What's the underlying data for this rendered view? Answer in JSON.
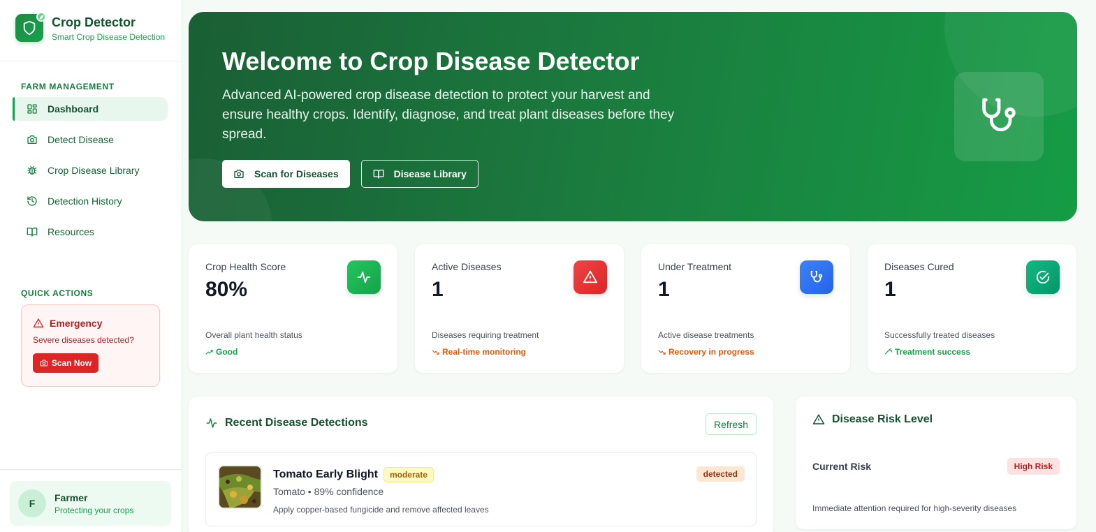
{
  "app": {
    "title": "Crop Detector",
    "subtitle": "Smart Crop Disease Detection"
  },
  "sidebar": {
    "section_label": "FARM MANAGEMENT",
    "items": [
      {
        "label": "Dashboard",
        "icon": "layout-grid-icon",
        "active": true
      },
      {
        "label": "Detect Disease",
        "icon": "camera-icon"
      },
      {
        "label": "Crop Disease Library",
        "icon": "bug-icon"
      },
      {
        "label": "Detection History",
        "icon": "history-icon"
      },
      {
        "label": "Resources",
        "icon": "book-open-icon"
      }
    ],
    "quick_actions_label": "QUICK ACTIONS",
    "emergency": {
      "title": "Emergency",
      "text": "Severe diseases detected?",
      "button": "Scan Now"
    },
    "user": {
      "initial": "F",
      "name": "Farmer",
      "subtitle": "Protecting your crops"
    }
  },
  "hero": {
    "title": "Welcome to Crop Disease Detector",
    "text": "Advanced AI-powered crop disease detection to protect your harvest and ensure healthy crops. Identify, diagnose, and treat plant diseases before they spread.",
    "primary_button": "Scan for Diseases",
    "secondary_button": "Disease Library",
    "icon": "stethoscope-icon"
  },
  "stats": [
    {
      "title": "Crop Health Score",
      "value": "80%",
      "desc": "Overall plant health status",
      "trend": "Good",
      "trend_color": "#16a34a",
      "icon": "activity-icon",
      "icon_bg": "#22c55e"
    },
    {
      "title": "Active Diseases",
      "value": "1",
      "desc": "Diseases requiring treatment",
      "trend": "Real-time monitoring",
      "trend_color": "#ea580c",
      "icon": "alert-triangle-icon",
      "icon_bg": "#ef4444"
    },
    {
      "title": "Under Treatment",
      "value": "1",
      "desc": "Active disease treatments",
      "trend": "Recovery in progress",
      "trend_color": "#ea580c",
      "icon": "stethoscope-icon",
      "icon_bg": "#3b82f6"
    },
    {
      "title": "Diseases Cured",
      "value": "1",
      "desc": "Successfully treated diseases",
      "trend": "Treatment success",
      "trend_color": "#16a34a",
      "icon": "check-circle-icon",
      "icon_bg": "#10b981"
    }
  ],
  "recent": {
    "title": "Recent Disease Detections",
    "refresh": "Refresh",
    "items": [
      {
        "name": "Tomato Early Blight",
        "severity": "moderate",
        "meta": "Tomato • 89% confidence",
        "note": "Apply copper-based fungicide and remove affected leaves",
        "status": "detected"
      }
    ]
  },
  "risk": {
    "title": "Disease Risk Level",
    "label": "Current Risk",
    "badge": "High Risk",
    "note": "Immediate attention required for high-severity diseases"
  }
}
